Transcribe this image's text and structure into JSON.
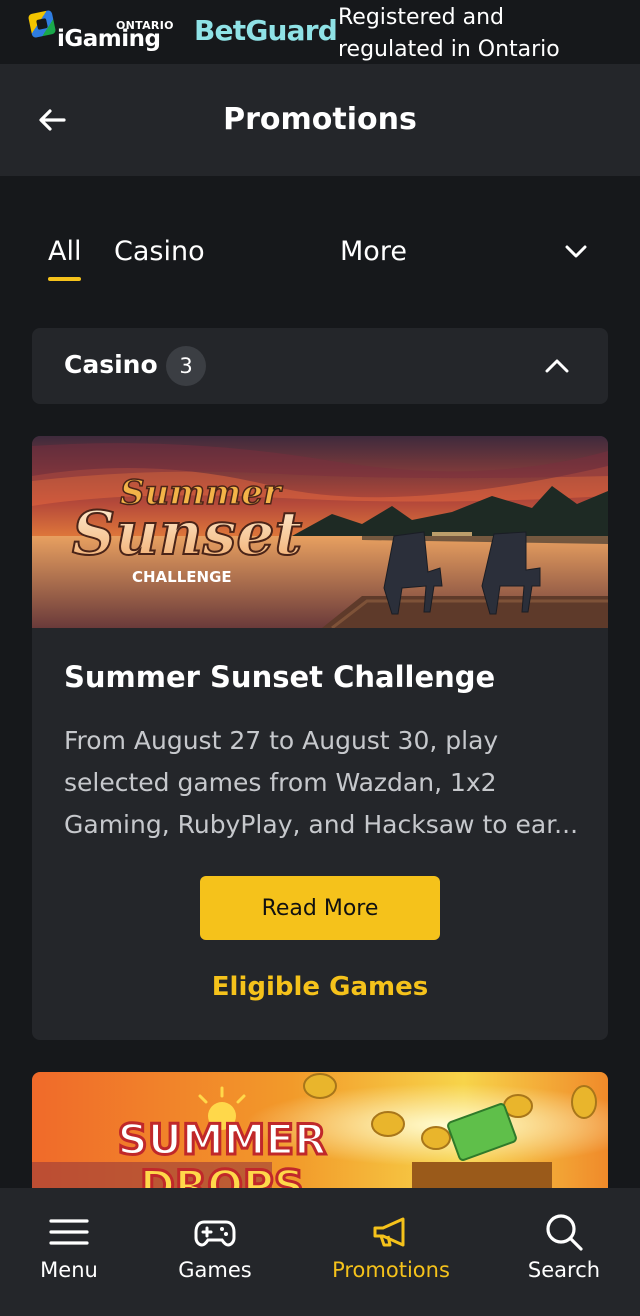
{
  "banner": {
    "igaming_brand": "iGaming",
    "igaming_region": "ONTARIO",
    "betguard": "BetGuard",
    "regulation_line1": "Registered and",
    "regulation_line2": "regulated in Ontario"
  },
  "header": {
    "back_icon": "arrow-left-icon",
    "title": "Promotions"
  },
  "tabs": {
    "items": [
      {
        "label": "All",
        "active": true
      },
      {
        "label": "Casino",
        "active": false
      },
      {
        "label": "More",
        "active": false
      }
    ],
    "more_icon": "chevron-down-icon"
  },
  "section": {
    "title": "Casino",
    "count": "3",
    "toggle_icon": "chevron-up-icon"
  },
  "promos": [
    {
      "image_title_top": "Summer",
      "image_title_main": "Sunset",
      "image_subtitle": "CHALLENGE",
      "title": "Summer Sunset Challenge",
      "description": "From August 27 to August 30, play selected games from Wazdan, 1x2 Gaming, RubyPlay, and Hacksaw to ear...",
      "read_more": "Read More",
      "eligible_games": "Eligible Games"
    },
    {
      "image_title_top": "SUMMER",
      "image_title_main": "DROPS"
    }
  ],
  "bottom_nav": [
    {
      "label": "Menu",
      "icon": "hamburger-icon",
      "active": false
    },
    {
      "label": "Games",
      "icon": "gamepad-icon",
      "active": false
    },
    {
      "label": "Promotions",
      "icon": "megaphone-icon",
      "active": true
    },
    {
      "label": "Search",
      "icon": "search-icon",
      "active": false
    }
  ],
  "colors": {
    "background": "#16181b",
    "surface": "#24262a",
    "accent": "#f5c21b",
    "betguard": "#8fe2e6"
  }
}
